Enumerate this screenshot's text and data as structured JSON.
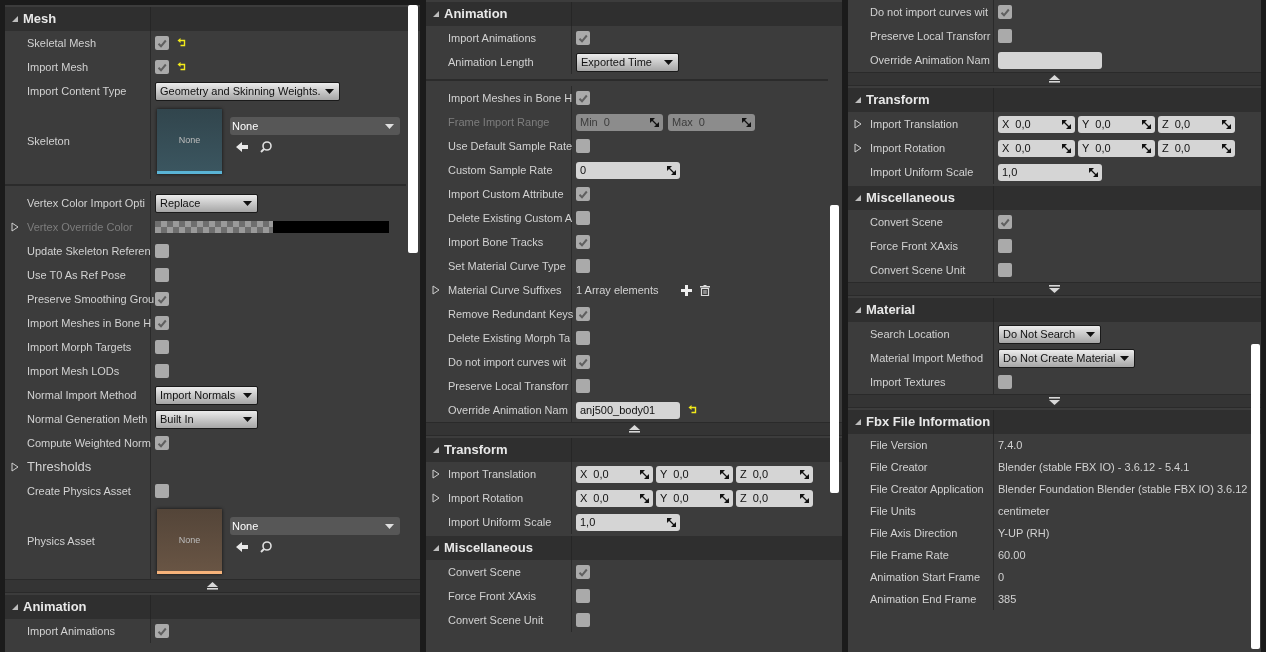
{
  "panels": [
    {
      "items": [
        {
          "kind": "section",
          "title": "Mesh",
          "expanded": true
        },
        {
          "kind": "check",
          "label": "Skeletal Mesh",
          "checked": true,
          "reset": true
        },
        {
          "kind": "check",
          "label": "Import Mesh",
          "checked": true,
          "reset": true
        },
        {
          "kind": "dropdown",
          "label": "Import Content Type",
          "value": "Geometry and Skinning Weights."
        },
        {
          "kind": "asset",
          "label": "Skeleton",
          "color": "#5ab4d6",
          "thumb_label": "None",
          "value": "None"
        },
        {
          "kind": "separator"
        },
        {
          "kind": "dropdown",
          "label": "Vertex Color Import Opti",
          "value": "Replace"
        },
        {
          "kind": "color",
          "label": "Vertex Override Color",
          "disabled": true,
          "expanded": false
        },
        {
          "kind": "check",
          "label": "Update Skeleton Referen",
          "checked": false
        },
        {
          "kind": "check",
          "label": "Use T0 As Ref Pose",
          "checked": false
        },
        {
          "kind": "check",
          "label": "Preserve Smoothing Grou",
          "checked": true
        },
        {
          "kind": "check",
          "label": "Import Meshes in Bone H",
          "checked": true
        },
        {
          "kind": "check",
          "label": "Import Morph Targets",
          "checked": false
        },
        {
          "kind": "check",
          "label": "Import Mesh LODs",
          "checked": false
        },
        {
          "kind": "dropdown",
          "label": "Normal Import Method",
          "value": "Import Normals"
        },
        {
          "kind": "dropdown",
          "label": "Normal Generation Meth",
          "value": "Built In"
        },
        {
          "kind": "check",
          "label": "Compute Weighted Norm",
          "checked": true
        },
        {
          "kind": "group",
          "label": "Thresholds",
          "expanded": false
        },
        {
          "kind": "check",
          "label": "Create Physics Asset",
          "checked": false
        },
        {
          "kind": "asset",
          "label": "Physics Asset",
          "color": "#f5b27a",
          "thumb_label": "None",
          "value": "None"
        },
        {
          "kind": "toggle",
          "expanded": true
        },
        {
          "kind": "section",
          "title": "Animation",
          "expanded": true
        },
        {
          "kind": "check",
          "label": "Import Animations",
          "checked": true
        }
      ]
    },
    {
      "items": [
        {
          "kind": "section",
          "title": "Animation",
          "expanded": true
        },
        {
          "kind": "check",
          "label": "Import Animations",
          "checked": true
        },
        {
          "kind": "dropdown",
          "label": "Animation Length",
          "value": "Exported Time"
        },
        {
          "kind": "separator"
        },
        {
          "kind": "check",
          "label": "Import Meshes in Bone H",
          "checked": true
        },
        {
          "kind": "range",
          "label": "Frame Import Range",
          "disabled": true,
          "fields": [
            {
              "axis": "Min",
              "value": "0"
            },
            {
              "axis": "Max",
              "value": "0"
            }
          ]
        },
        {
          "kind": "check",
          "label": "Use Default Sample Rate",
          "checked": false
        },
        {
          "kind": "number",
          "label": "Custom Sample Rate",
          "value": "0"
        },
        {
          "kind": "check",
          "label": "Import Custom Attribute",
          "checked": true
        },
        {
          "kind": "check",
          "label": "Delete Existing Custom A",
          "checked": false
        },
        {
          "kind": "check",
          "label": "Import Bone Tracks",
          "checked": true
        },
        {
          "kind": "check",
          "label": "Set Material Curve Type",
          "checked": false
        },
        {
          "kind": "array",
          "label": "Material Curve Suffixes",
          "value": "1 Array elements",
          "expanded": false
        },
        {
          "kind": "check",
          "label": "Remove Redundant Keys",
          "checked": true
        },
        {
          "kind": "check",
          "label": "Delete Existing Morph Ta",
          "checked": false
        },
        {
          "kind": "check",
          "label": "Do not import curves wit",
          "checked": true
        },
        {
          "kind": "check",
          "label": "Preserve Local Transforr",
          "checked": false
        },
        {
          "kind": "text",
          "label": "Override Animation Nam",
          "value": "anj500_body01",
          "reset": true
        },
        {
          "kind": "toggle",
          "expanded": true
        },
        {
          "kind": "section",
          "title": "Transform",
          "expanded": true
        },
        {
          "kind": "vector",
          "label": "Import Translation",
          "expanded": false,
          "fields": [
            {
              "axis": "X",
              "value": "0,0"
            },
            {
              "axis": "Y",
              "value": "0,0"
            },
            {
              "axis": "Z",
              "value": "0,0"
            }
          ]
        },
        {
          "kind": "vector",
          "label": "Import Rotation",
          "expanded": false,
          "fields": [
            {
              "axis": "X",
              "value": "0,0"
            },
            {
              "axis": "Y",
              "value": "0,0"
            },
            {
              "axis": "Z",
              "value": "0,0"
            }
          ]
        },
        {
          "kind": "number",
          "label": "Import Uniform Scale",
          "value": "1,0"
        },
        {
          "kind": "section",
          "title": "Miscellaneous",
          "expanded": true
        },
        {
          "kind": "check",
          "label": "Convert Scene",
          "checked": true
        },
        {
          "kind": "check",
          "label": "Force Front XAxis",
          "checked": false
        },
        {
          "kind": "check",
          "label": "Convert Scene Unit",
          "checked": false
        }
      ]
    },
    {
      "items": [
        {
          "kind": "check",
          "label": "Do not import curves wit",
          "checked": true
        },
        {
          "kind": "check",
          "label": "Preserve Local Transforr",
          "checked": false
        },
        {
          "kind": "text",
          "label": "Override Animation Nam"
        },
        {
          "kind": "toggle",
          "expanded": true
        },
        {
          "kind": "section",
          "title": "Transform",
          "expanded": true
        },
        {
          "kind": "vector",
          "label": "Import Translation",
          "expanded": false,
          "fields": [
            {
              "axis": "X",
              "value": "0,0"
            },
            {
              "axis": "Y",
              "value": "0,0"
            },
            {
              "axis": "Z",
              "value": "0,0"
            }
          ]
        },
        {
          "kind": "vector",
          "label": "Import Rotation",
          "expanded": false,
          "fields": [
            {
              "axis": "X",
              "value": "0,0"
            },
            {
              "axis": "Y",
              "value": "0,0"
            },
            {
              "axis": "Z",
              "value": "0,0"
            }
          ]
        },
        {
          "kind": "number",
          "label": "Import Uniform Scale",
          "value": "1,0"
        },
        {
          "kind": "section",
          "title": "Miscellaneous",
          "expanded": true
        },
        {
          "kind": "check",
          "label": "Convert Scene",
          "checked": true
        },
        {
          "kind": "check",
          "label": "Force Front XAxis",
          "checked": false
        },
        {
          "kind": "check",
          "label": "Convert Scene Unit",
          "checked": false
        },
        {
          "kind": "toggle",
          "expanded": false
        },
        {
          "kind": "section",
          "title": "Material",
          "expanded": true
        },
        {
          "kind": "dropdown",
          "label": "Search Location",
          "value": "Do Not Search"
        },
        {
          "kind": "dropdown",
          "label": "Material Import Method",
          "value": "Do Not Create Material"
        },
        {
          "kind": "check",
          "label": "Import Textures",
          "checked": false
        },
        {
          "kind": "toggle",
          "expanded": false
        },
        {
          "kind": "section",
          "title": "Fbx File Information",
          "expanded": true
        },
        {
          "kind": "info",
          "label": "File Version",
          "value": "7.4.0"
        },
        {
          "kind": "info",
          "label": "File Creator",
          "value": "Blender (stable FBX IO) - 3.6.12 - 5.4.1"
        },
        {
          "kind": "info",
          "label": "File Creator Application",
          "value": "Blender Foundation Blender (stable FBX IO) 3.6.12"
        },
        {
          "kind": "info",
          "label": "File Units",
          "value": "centimeter"
        },
        {
          "kind": "info",
          "label": "File Axis Direction",
          "value": "Y-UP (RH)"
        },
        {
          "kind": "info",
          "label": "File Frame Rate",
          "value": "60.00"
        },
        {
          "kind": "info",
          "label": "Animation Start Frame",
          "value": "0"
        },
        {
          "kind": "info",
          "label": "Animation End Frame",
          "value": "385"
        }
      ]
    }
  ]
}
